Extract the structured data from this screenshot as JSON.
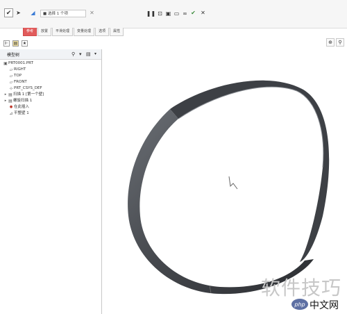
{
  "toolbar": {
    "selection_field": "■ 选择 1 个项",
    "check_label": "✔",
    "cancel_label": "✕"
  },
  "tabs": [
    {
      "label": "参考",
      "active": true
    },
    {
      "label": "放置",
      "active": false
    },
    {
      "label": "平滑处理",
      "active": false
    },
    {
      "label": "变量处理",
      "active": false
    },
    {
      "label": "选项",
      "active": false
    },
    {
      "label": "属性",
      "active": false
    }
  ],
  "tree": {
    "title": "模型树",
    "items": [
      {
        "icon": "part-icon",
        "glyph": "▣",
        "label": "PRT0001.PRT",
        "indent": 0
      },
      {
        "icon": "plane-icon",
        "glyph": "▱",
        "label": "RIGHT",
        "indent": 1
      },
      {
        "icon": "plane-icon",
        "glyph": "▱",
        "label": "TOP",
        "indent": 1
      },
      {
        "icon": "plane-icon",
        "glyph": "▱",
        "label": "FRONT",
        "indent": 1
      },
      {
        "icon": "csys-icon",
        "glyph": "⊹",
        "label": "PRT_CSYS_DEF",
        "indent": 1
      },
      {
        "icon": "sweep-icon",
        "glyph": "▤",
        "label": "扫描 1 [第一个壁]",
        "indent": 1,
        "expandable": true
      },
      {
        "icon": "sketch-icon",
        "glyph": "▤",
        "label": "螺旋扫描 1",
        "indent": 1,
        "expandable": true
      },
      {
        "icon": "insert-icon",
        "glyph": "●",
        "label": "在此插入",
        "indent": 1
      },
      {
        "icon": "flat-icon",
        "glyph": "⊿",
        "label": "平整壁 1",
        "indent": 1
      }
    ]
  },
  "watermark": "软件技巧",
  "brand": {
    "logo": "php",
    "text": "中文网"
  },
  "colors": {
    "active_tab": "#e15b5b",
    "ring": "#4a4d52",
    "ring_dark": "#2e3034"
  }
}
